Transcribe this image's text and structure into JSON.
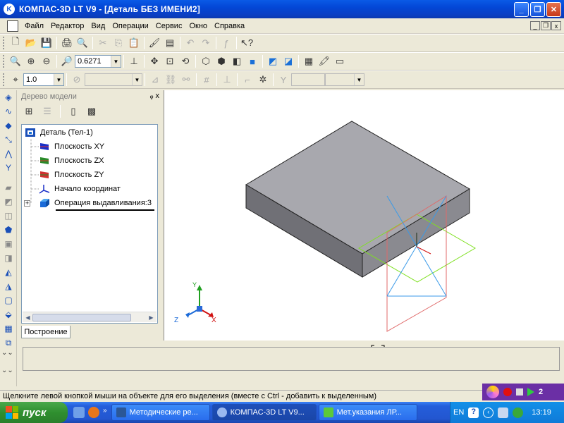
{
  "window": {
    "title": "КОМПАС-3D LT V9 - [Деталь БЕЗ ИМЕНИ2]",
    "minimize": "_",
    "restore": "❐",
    "close": "✕"
  },
  "menu": {
    "items": [
      "Файл",
      "Редактор",
      "Вид",
      "Операции",
      "Сервис",
      "Окно",
      "Справка"
    ],
    "mdi_min": "_",
    "mdi_restore": "❐",
    "mdi_close": "x"
  },
  "toolbar_view": {
    "zoom_value": "0.6271"
  },
  "toolbar_grid": {
    "step_value": "1.0"
  },
  "tree_panel": {
    "title": "Дерево модели",
    "pin": "ᵩ x",
    "root": "Деталь (Тел-1)",
    "items": [
      "Плоскость XY",
      "Плоскость ZX",
      "Плоскость ZY",
      "Начало координат",
      "Операция выдавливания:3"
    ],
    "expand": "+",
    "tab_label": "Построение"
  },
  "axes": {
    "x": "X",
    "y": "Y",
    "z": "Z"
  },
  "command": {
    "cursor_glyph": "+"
  },
  "status": {
    "text": "Щелкните левой кнопкой мыши на объекте для его выделения (вместе с Ctrl - добавить к выделенным)"
  },
  "recorder": {
    "counter": "2"
  },
  "taskbar": {
    "start_label": "пуск",
    "tasks": [
      "Методические ре...",
      "КОМПАС-3D LT V9...",
      "Мет.указания ЛР..."
    ],
    "language": "EN",
    "time": "13:19"
  },
  "colors": {
    "titlebar": "#0a5ae6",
    "part_top": "#a8a8ae",
    "part_front": "#6e6e74",
    "part_side": "#8a8a90",
    "plane_xy": "#7fe020",
    "plane_zx": "#e06a6a",
    "plane_zy": "#3a9ae8"
  }
}
